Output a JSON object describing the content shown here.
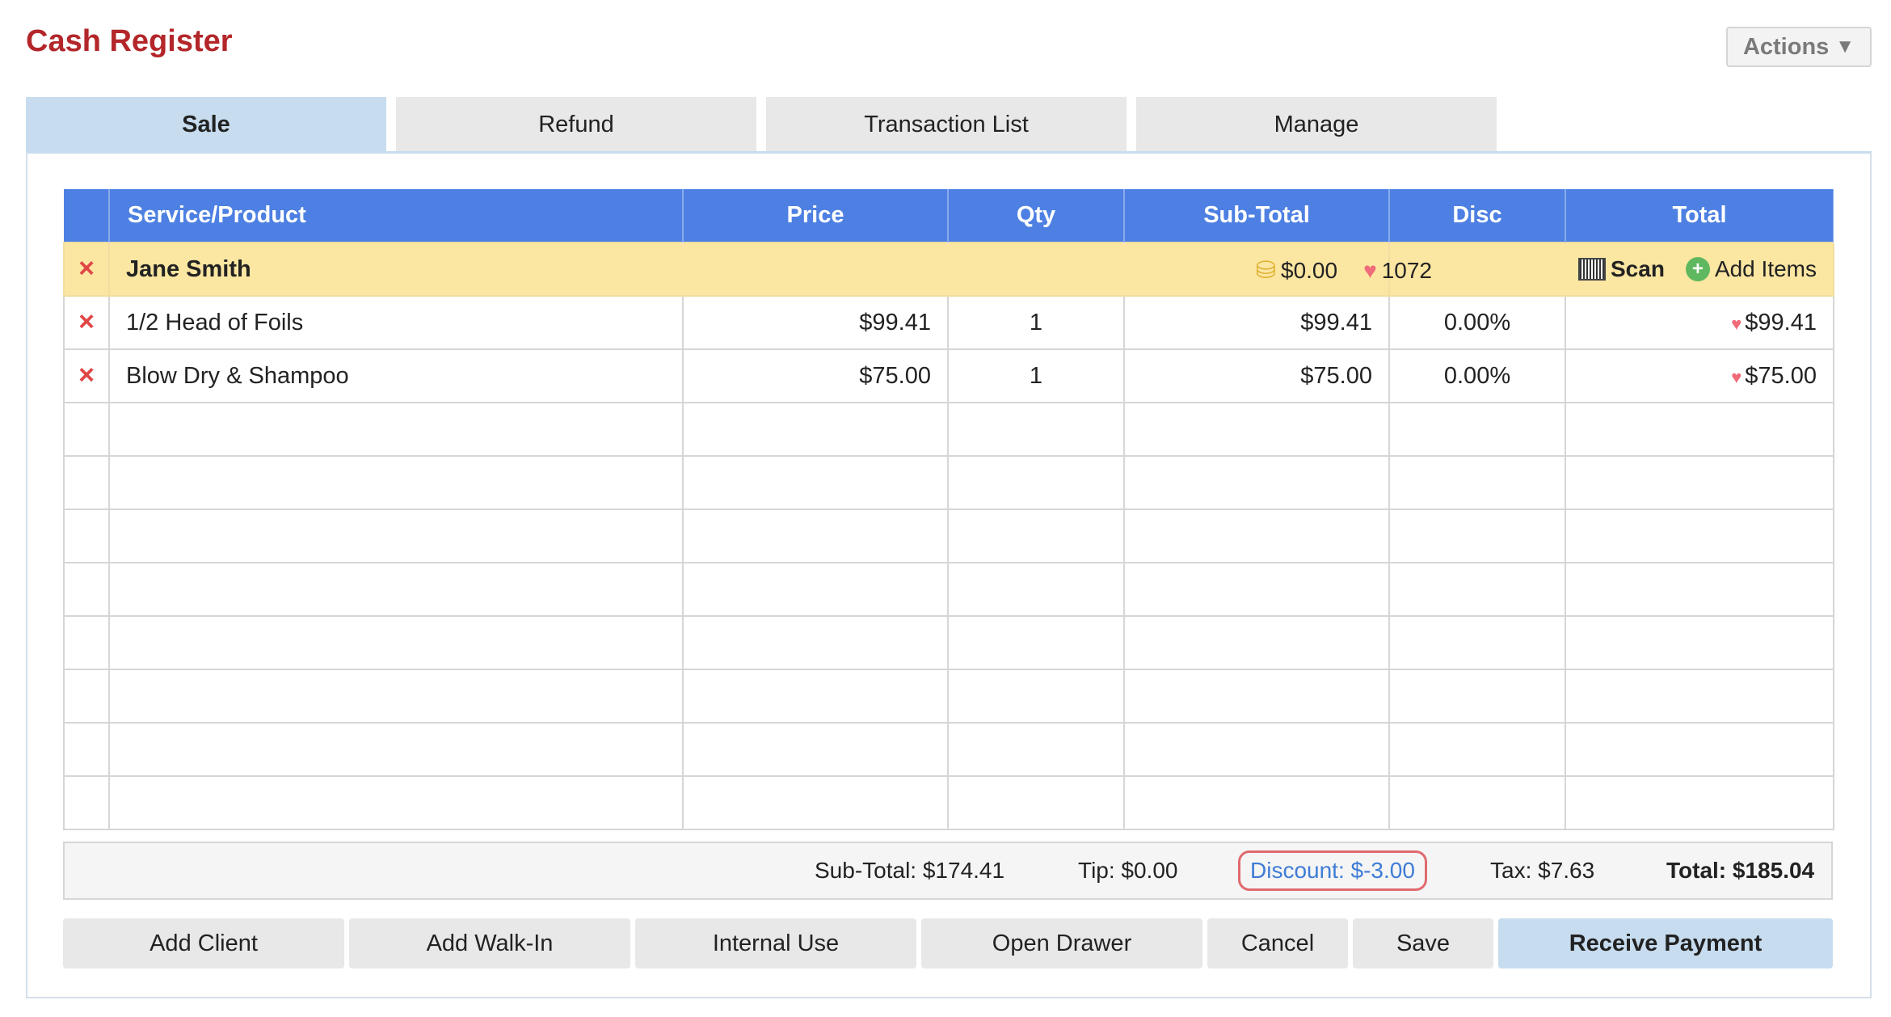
{
  "header": {
    "title": "Cash Register",
    "actions_label": "Actions",
    "actions_arrow": "▼"
  },
  "tabs": [
    {
      "label": "Sale",
      "active": true
    },
    {
      "label": "Refund"
    },
    {
      "label": "Transaction List"
    },
    {
      "label": "Manage"
    }
  ],
  "table": {
    "columns": [
      "",
      "Service/Product",
      "Price",
      "Qty",
      "Sub-Total",
      "Disc",
      "Total"
    ],
    "client": {
      "name": "Jane Smith",
      "balance": "$0.00",
      "points": "1072",
      "scan_label": "Scan",
      "add_items_label": "Add Items"
    },
    "items": [
      {
        "name": "1/2 Head of Foils",
        "price": "$99.41",
        "qty": "1",
        "subtotal": "$99.41",
        "disc": "0.00%",
        "total": "$99.41"
      },
      {
        "name": "Blow Dry & Shampoo",
        "price": "$75.00",
        "qty": "1",
        "subtotal": "$75.00",
        "disc": "0.00%",
        "total": "$75.00"
      }
    ]
  },
  "totals": {
    "subtotal": "Sub-Total: $174.41",
    "tip": "Tip: $0.00",
    "discount": "Discount: $-3.00",
    "tax": "Tax: $7.63",
    "total": "Total: $185.04"
  },
  "buttons": {
    "add_client": "Add Client",
    "add_walkin": "Add Walk-In",
    "internal_use": "Internal Use",
    "open_drawer": "Open Drawer",
    "cancel": "Cancel",
    "save": "Save",
    "receive_payment": "Receive Payment"
  },
  "icons": {
    "remove": "×",
    "coins": "⛁",
    "heart": "♥",
    "plus": "+"
  },
  "colors": {
    "title": "#b3262a",
    "header_bg": "#4d80e2",
    "client_row": "#fbe6a2",
    "active_tab": "#c7dcee",
    "discount_link": "#3e7cd6",
    "remove_icon": "#e04646"
  }
}
